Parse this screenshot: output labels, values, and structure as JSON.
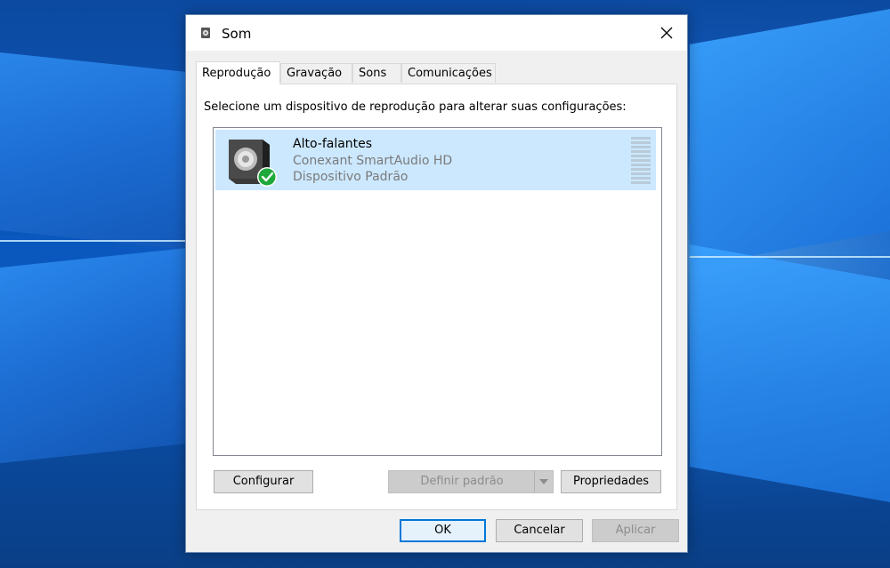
{
  "window": {
    "title": "Som",
    "close_label": "Fechar"
  },
  "tabs": [
    {
      "label": "Reprodução",
      "active": true
    },
    {
      "label": "Gravação",
      "active": false
    },
    {
      "label": "Sons",
      "active": false
    },
    {
      "label": "Comunicações",
      "active": false
    }
  ],
  "instruction": "Selecione um dispositivo de reprodução para alterar suas configurações:",
  "devices": [
    {
      "name": "Alto-falantes",
      "driver": "Conexant SmartAudio HD",
      "status": "Dispositivo Padrão",
      "icon": "speaker-icon",
      "badge": "default-check-icon",
      "selected": true
    }
  ],
  "buttons": {
    "configure": "Configurar",
    "set_default": "Definir padrão",
    "properties": "Propriedades",
    "ok": "OK",
    "cancel": "Cancelar",
    "apply": "Aplicar"
  },
  "colors": {
    "selection": "#cce8ff",
    "accent": "#0078d7",
    "check": "#1fa83a"
  }
}
